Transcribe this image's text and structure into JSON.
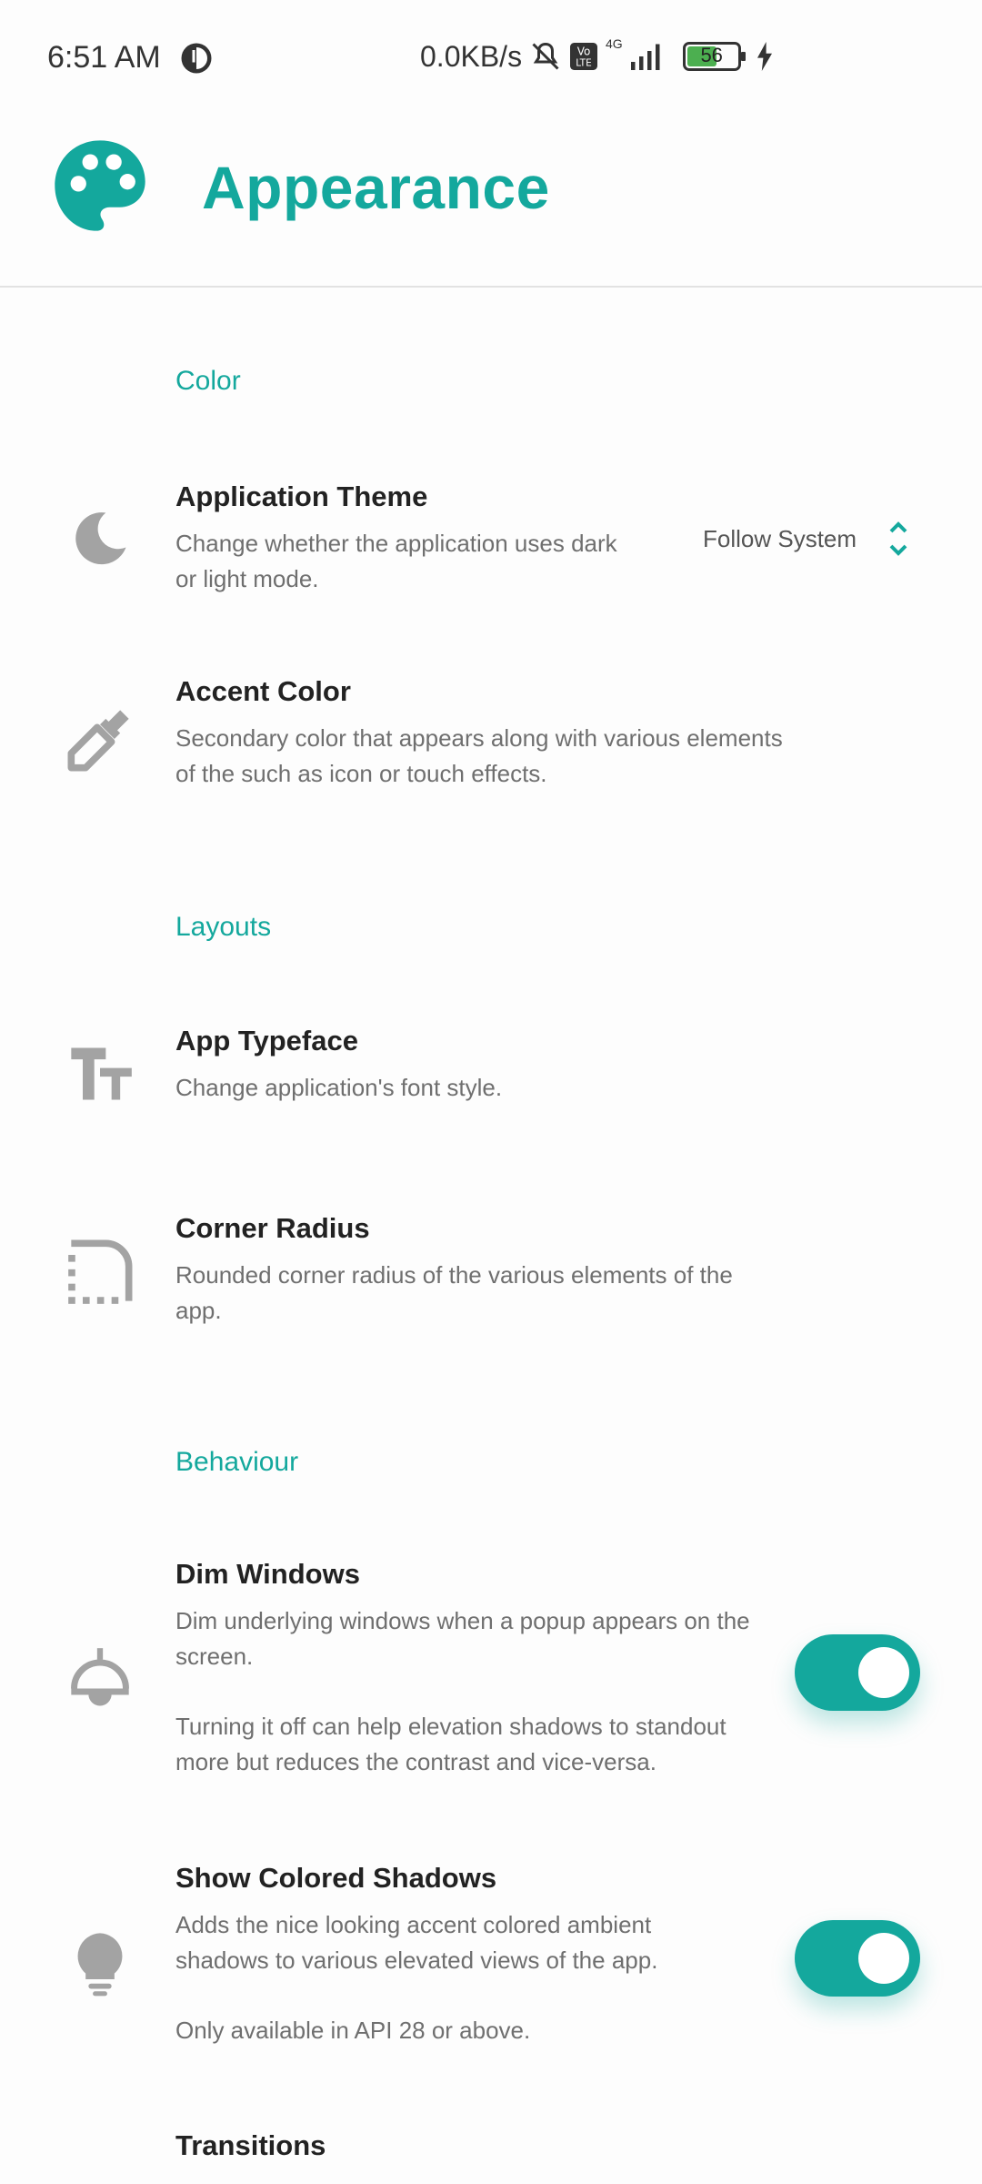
{
  "status_bar": {
    "time": "6:51 AM",
    "net_speed": "0.0KB/s",
    "network": "4G",
    "volte": "Vo LTE",
    "battery": "56",
    "icons": [
      "alert-icon",
      "mute-icon",
      "volte-icon",
      "signal-icon",
      "battery-icon",
      "charging-icon"
    ]
  },
  "header": {
    "title": "Appearance",
    "icon": "palette-icon"
  },
  "sections": {
    "color": "Color",
    "layouts": "Layouts",
    "behaviour": "Behaviour"
  },
  "settings": {
    "app_theme": {
      "title": "Application Theme",
      "desc1": "Change whether the application uses dark",
      "desc2": "or light mode.",
      "value": "Follow System",
      "icon": "moon-icon"
    },
    "accent_color": {
      "title": "Accent Color",
      "desc1": "Secondary color that appears along with various elements",
      "desc2": "of the such as icon or touch effects.",
      "icon": "eyedropper-icon"
    },
    "typeface": {
      "title": "App Typeface",
      "desc1": "Change application's font style.",
      "icon": "text-size-icon"
    },
    "corner_radius": {
      "title": "Corner Radius",
      "desc1": "Rounded corner radius of the various elements of the",
      "desc2": "app.",
      "icon": "corner-radius-icon"
    },
    "dim_windows": {
      "title": "Dim Windows",
      "desc1": "Dim underlying windows when a popup appears on the",
      "desc2": "screen.",
      "desc3": "Turning it off can help elevation shadows to standout",
      "desc4": "more but reduces the contrast and vice-versa.",
      "enabled": true,
      "icon": "lamp-icon"
    },
    "colored_shadows": {
      "title": "Show Colored Shadows",
      "desc1": "Adds the nice looking accent colored ambient",
      "desc2": "shadows to various elevated views of the app.",
      "desc3": "Only available in API 28 or above.",
      "enabled": true,
      "icon": "lightbulb-icon"
    },
    "transitions": {
      "title": "Transitions"
    }
  },
  "colors": {
    "accent": "#14a89d",
    "icon_gray": "#9e9e9e",
    "text_secondary": "#6f6f6f"
  }
}
